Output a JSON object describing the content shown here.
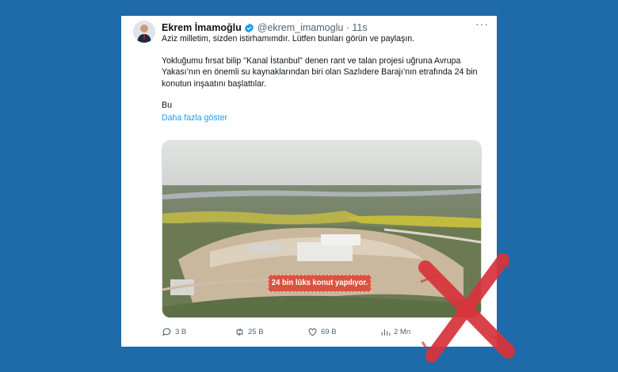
{
  "tweet": {
    "author_name": "Ekrem İmamoğlu",
    "handle_time": "@ekrem_imamoglu · 11s",
    "more_glyph": "···",
    "line1": "Aziz milletim, sizden istirhamımdır. Lütfen bunları görün ve paylaşın.",
    "paragraph2": "Yokluğumu fırsat bilip \"Kanal İstanbul\"  denen rant ve talan projesi uğruna Avrupa Yakası’nın en önemli su kaynaklarından biri olan Sazlıdere Barajı’nın etrafında 24 bin konutun inşaatını  başlattılar.",
    "line3": "Bu",
    "show_more": "Daha fazla göster",
    "video_caption": "24 bin lüks konut yapılıyor."
  },
  "actions": {
    "replies": "3 B",
    "retweets": "25 B",
    "likes": "69 B",
    "views": "2 Mn"
  },
  "colors": {
    "page_background": "#1f6aa8",
    "link": "#1d9bf0",
    "verified_badge": "#1d9bf0",
    "red_x": "#d8343c"
  }
}
